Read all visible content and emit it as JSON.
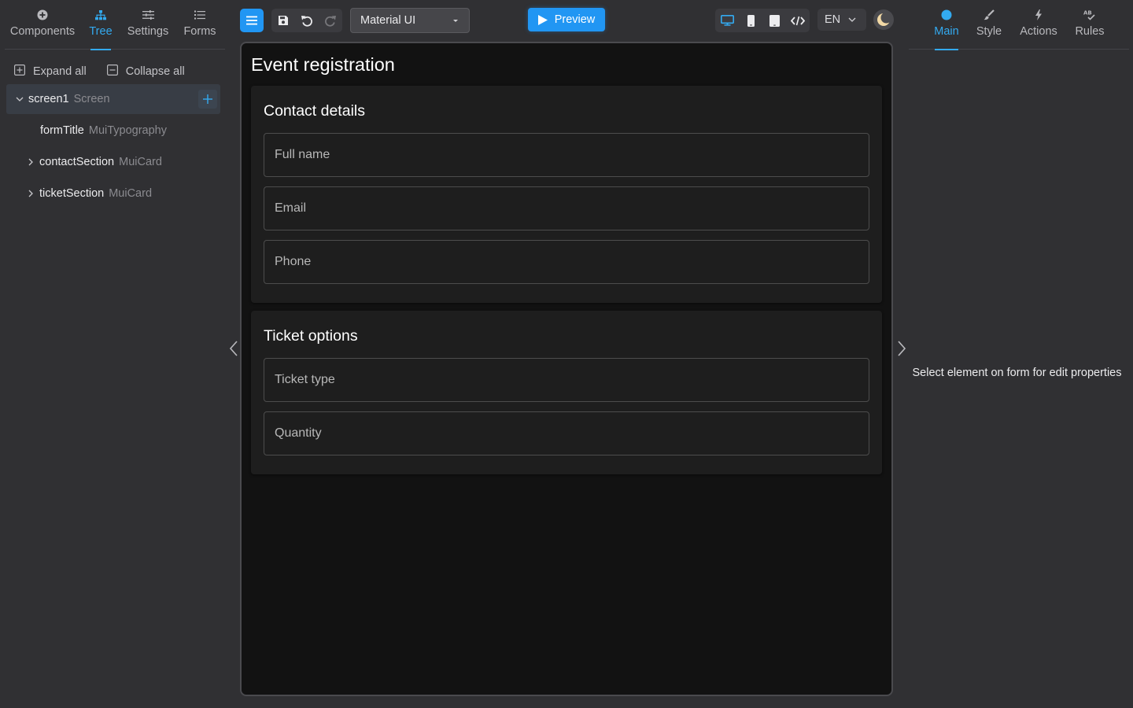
{
  "left_tabs": [
    {
      "label": "Components",
      "icon": "plus-circle-icon"
    },
    {
      "label": "Tree",
      "icon": "hierarchy-icon",
      "active": true
    },
    {
      "label": "Settings",
      "icon": "sliders-icon"
    },
    {
      "label": "Forms",
      "icon": "list-icon"
    }
  ],
  "tree_actions": {
    "expand_all": "Expand all",
    "collapse_all": "Collapse all"
  },
  "tree": [
    {
      "name": "screen1",
      "type": "Screen",
      "expanded": true,
      "selected": true
    },
    {
      "name": "formTitle",
      "type": "MuiTypography"
    },
    {
      "name": "contactSection",
      "type": "MuiCard",
      "expanded": false
    },
    {
      "name": "ticketSection",
      "type": "MuiCard",
      "expanded": false
    }
  ],
  "toolbar": {
    "theme_select": "Material UI",
    "preview": "Preview",
    "language": "EN"
  },
  "form": {
    "title": "Event registration",
    "sections": [
      {
        "title": "Contact details",
        "fields": [
          "Full name",
          "Email",
          "Phone"
        ]
      },
      {
        "title": "Ticket options",
        "fields": [
          "Ticket type",
          "Quantity"
        ]
      }
    ]
  },
  "right_tabs": [
    {
      "label": "Main",
      "icon": "dot-icon",
      "active": true
    },
    {
      "label": "Style",
      "icon": "brush-icon"
    },
    {
      "label": "Actions",
      "icon": "bolt-icon"
    },
    {
      "label": "Rules",
      "icon": "spellcheck-icon"
    }
  ],
  "properties": {
    "empty_message": "Select element on form for edit properties"
  },
  "colors": {
    "accent": "#2196f3",
    "background": "#303033",
    "canvas": "#121212",
    "card": "#1e1e1e"
  }
}
